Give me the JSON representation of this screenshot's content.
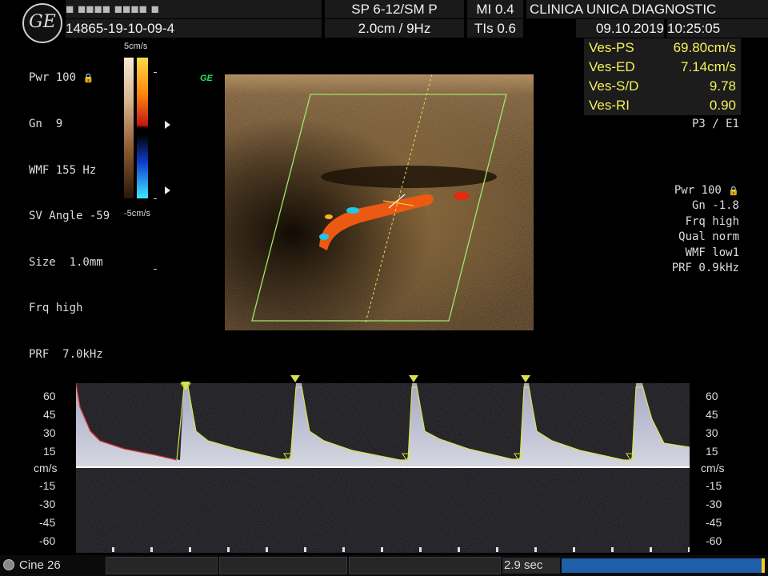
{
  "header": {
    "patient_name": "■ ■■■■ ■■■■ ■",
    "patient_id": "14865-19-10-09-4",
    "probe": "SP 6-12/SM P",
    "depth_freq": "2.0cm / 9Hz",
    "mi": "MI 0.4",
    "tis": "TIs 0.6",
    "clinic": "CLINICA UNICA DIAGNOSTIC",
    "date": "09.10.2019",
    "time": "10:25:05",
    "logo": "GE"
  },
  "left_params": {
    "line1": "Pwr 100",
    "line2": "Gn  9",
    "line3": "WMF 155 Hz",
    "line4": "SV Angle -59",
    "line5": "Size  1.0mm",
    "line6": "Frq high",
    "line7": "PRF  7.0kHz",
    "scale_top": "5cm/s",
    "scale_bottom": "-5cm/s"
  },
  "measurements": [
    {
      "label": "Ves-PS",
      "value": "69.80cm/s"
    },
    {
      "label": "Ves-ED",
      "value": "7.14cm/s"
    },
    {
      "label": "Ves-S/D",
      "value": "9.78"
    },
    {
      "label": "Ves-RI",
      "value": "0.90"
    }
  ],
  "preset": "P3 / E1",
  "right_params": {
    "line1": "Pwr 100",
    "line2": "Gn -1.8",
    "line3": "Frq high",
    "line4": "Qual norm",
    "line5": "WMF low1",
    "line6": "PRF  0.9kHz"
  },
  "ge_mark": "GE",
  "doppler_axis": {
    "unit": "cm/s",
    "ticks": [
      "60",
      "45",
      "30",
      "15",
      "-15",
      "-30",
      "-45",
      "-60"
    ]
  },
  "footer": {
    "cine": "Cine 26",
    "duration": "2.9 sec"
  },
  "colors": {
    "measurement_text": "#f5f25a",
    "roi_box": "#9de86a",
    "envelope": "#d8e24a",
    "flow_red": "#e84a10",
    "flow_blue": "#20c8e8"
  }
}
